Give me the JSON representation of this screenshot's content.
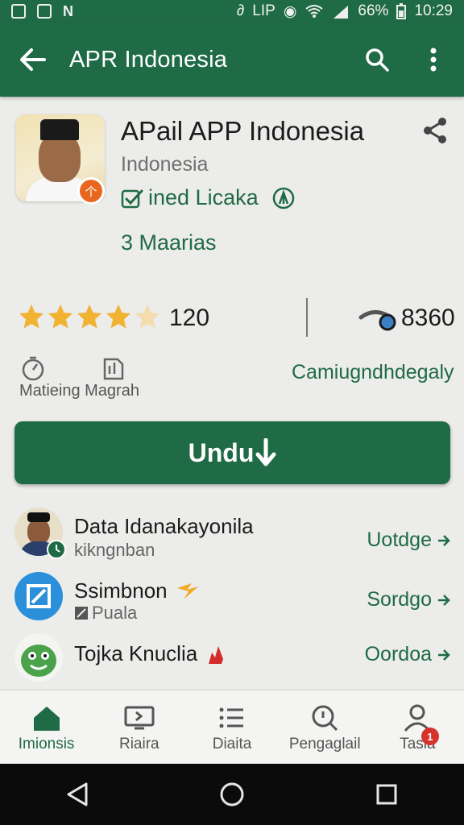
{
  "status_bar": {
    "battery": "66%",
    "time": "10:29",
    "carrier": "LIP"
  },
  "app_bar": {
    "title": "APR Indonesia"
  },
  "app": {
    "name": "APail APP Indonesia",
    "country": "Indonesia",
    "verified_text": "ined Licaka",
    "badge_glyph": "个",
    "maarias": "3 Maarias"
  },
  "stats": {
    "rating_stars": 4,
    "rating_count": "120",
    "downloads": "8360"
  },
  "meta": {
    "labels": "Matieing Magrah",
    "link": "Camiugndhdegaly"
  },
  "install_button": {
    "label": "Undu"
  },
  "related": [
    {
      "title": "Data Idanakayonila",
      "subtitle": "kikngnban",
      "action": "Uotdge"
    },
    {
      "title": "Ssimbnon",
      "subtitle": "Puala",
      "action": "Sordgo"
    },
    {
      "title": "Tojka Knuclia",
      "subtitle": "",
      "action": "Oordoa"
    }
  ],
  "bottom_nav": [
    {
      "label": "Imionsis",
      "icon": "home-icon"
    },
    {
      "label": "Riaira",
      "icon": "tv-icon"
    },
    {
      "label": "Diaita",
      "icon": "list-icon"
    },
    {
      "label": "Pengaglail",
      "icon": "search-icon"
    },
    {
      "label": "Tasia",
      "icon": "person-icon",
      "badge": "1"
    }
  ],
  "colors": {
    "primary": "#1f6b45",
    "star": "#f2b232",
    "badge": "#d8322d"
  }
}
